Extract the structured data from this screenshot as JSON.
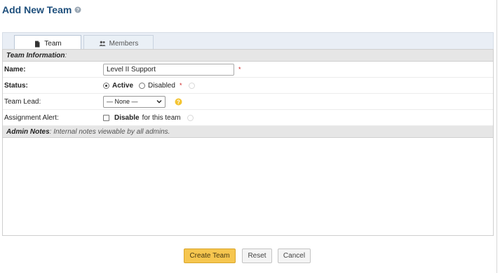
{
  "page": {
    "title": "Add New Team"
  },
  "tabs": [
    {
      "label": "Team",
      "icon": "document-icon",
      "active": true
    },
    {
      "label": "Members",
      "icon": "users-icon",
      "active": false
    }
  ],
  "team_information": {
    "header": "Team Information",
    "header_suffix": ":",
    "fields": {
      "name": {
        "label": "Name:",
        "value": "Level II Support",
        "required_mark": "*"
      },
      "status": {
        "label": "Status:",
        "options": [
          "Active",
          "Disabled"
        ],
        "selected": "Active",
        "required_mark": "*"
      },
      "team_lead": {
        "label": "Team Lead:",
        "selected": "— None —"
      },
      "assignment_alert": {
        "label": "Assignment Alert:",
        "checkbox_label_bold": "Disable",
        "checkbox_label_rest": "for this team",
        "checked": false
      }
    }
  },
  "admin_notes": {
    "header": "Admin Notes",
    "description": ": Internal notes viewable by all admins."
  },
  "actions": {
    "create": "Create Team",
    "reset": "Reset",
    "cancel": "Cancel"
  },
  "colors": {
    "title": "#1e4f7c",
    "primary_button": "#f6c64f",
    "required": "#cc2222",
    "section_header": "#e6e6e6"
  }
}
